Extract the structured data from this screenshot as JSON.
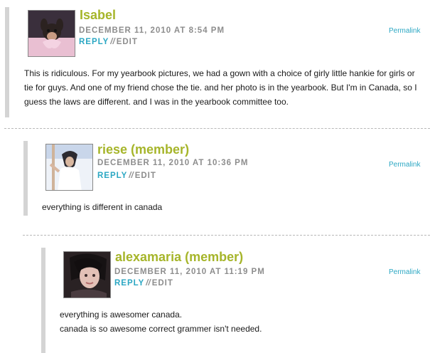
{
  "comments": [
    {
      "author": "Isabel",
      "date": "DECEMBER 11, 2010 AT 8:54 PM",
      "reply": "REPLY",
      "separator": "//",
      "edit": "EDIT",
      "permalink": "Permalink",
      "lines": [
        "This is ridiculous. For my yearbook pictures, we had a gown with a choice of girly little hankie for girls or",
        "tie for guys. And one of my friend chose the tie. and her photo is in the yearbook. But I'm in Canada, so I",
        "guess the laws are different. and I was in the yearbook committee too."
      ]
    },
    {
      "author": "riese (member)",
      "date": "DECEMBER 11, 2010 AT 10:36 PM",
      "reply": "REPLY",
      "separator": "//",
      "edit": "EDIT",
      "permalink": "Permalink",
      "lines": [
        "everything is different in canada"
      ]
    },
    {
      "author": "alexamaria (member)",
      "date": "DECEMBER 11, 2010 AT 11:19 PM",
      "reply": "REPLY",
      "separator": "//",
      "edit": "EDIT",
      "permalink": "Permalink",
      "lines": [
        "everything is awesomer canada.",
        "canada is so awesome correct grammer isn't needed."
      ]
    }
  ],
  "colors": {
    "author": "#a6b52a",
    "link": "#2ba7c3",
    "meta": "#8d8d8d",
    "bar": "#d4d4d4"
  }
}
